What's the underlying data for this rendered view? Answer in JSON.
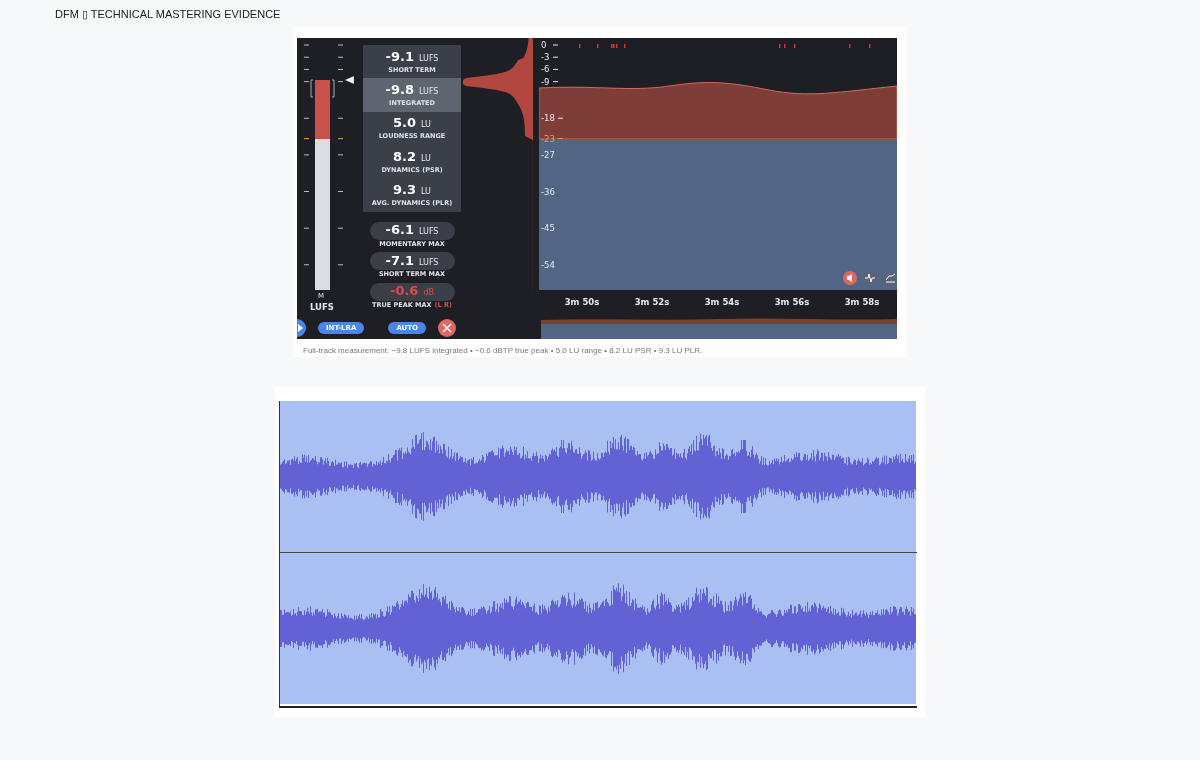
{
  "header": {
    "title": "DFM ▯ TECHNICAL MASTERING EVIDENCE"
  },
  "meter_figure": {
    "stats": [
      {
        "value": "-9.1",
        "unit": "LUFS",
        "label": "SHORT TERM",
        "selected": false
      },
      {
        "value": "-9.8",
        "unit": "LUFS",
        "label": "INTEGRATED",
        "selected": true
      },
      {
        "value": "5.0",
        "unit": "LU",
        "label": "LOUDNESS RANGE",
        "selected": false
      },
      {
        "value": "8.2",
        "unit": "LU",
        "label": "DYNAMICS (PSR)",
        "selected": false
      },
      {
        "value": "9.3",
        "unit": "LU",
        "label": "AVG. DYNAMICS (PLR)",
        "selected": false
      }
    ],
    "max_readings": [
      {
        "value": "-6.1",
        "unit": "LUFS",
        "label": "MOMENTARY MAX",
        "warning": false
      },
      {
        "value": "-7.1",
        "unit": "LUFS",
        "label": "SHORT TERM MAX",
        "warning": false
      },
      {
        "value": "-0.6",
        "unit": "dB",
        "label": "TRUE PEAK MAX",
        "channels": "(L R)",
        "warning": true
      }
    ],
    "meter_labels": {
      "channel": "M",
      "unit": "LUFS"
    },
    "buttons": [
      {
        "label": "INT-LRA"
      },
      {
        "label": "AUTO"
      }
    ],
    "y_ticks": [
      {
        "label": "0",
        "target": false
      },
      {
        "label": "-3",
        "target": false
      },
      {
        "label": "-6",
        "target": false
      },
      {
        "label": "-9",
        "target": false
      },
      {
        "label": "-18",
        "target": false
      },
      {
        "label": "-23",
        "target": true
      },
      {
        "label": "-27",
        "target": false
      },
      {
        "label": "-36",
        "target": false
      },
      {
        "label": "-45",
        "target": false
      },
      {
        "label": "-54",
        "target": false
      }
    ],
    "x_labels": [
      "3m 50s",
      "3m 52s",
      "3m 54s",
      "3m 56s",
      "3m 58s"
    ],
    "caption": "Full-track measurement: −9.8 LUFS integrated • −0.6 dBTP true peak • 5.0 LU range • 8.2 LU PSR • 9.3 LU PLR."
  },
  "waveform_figure": {
    "tracks": [
      {
        "kind": "waveform"
      },
      {
        "kind": "waveform"
      }
    ]
  }
}
